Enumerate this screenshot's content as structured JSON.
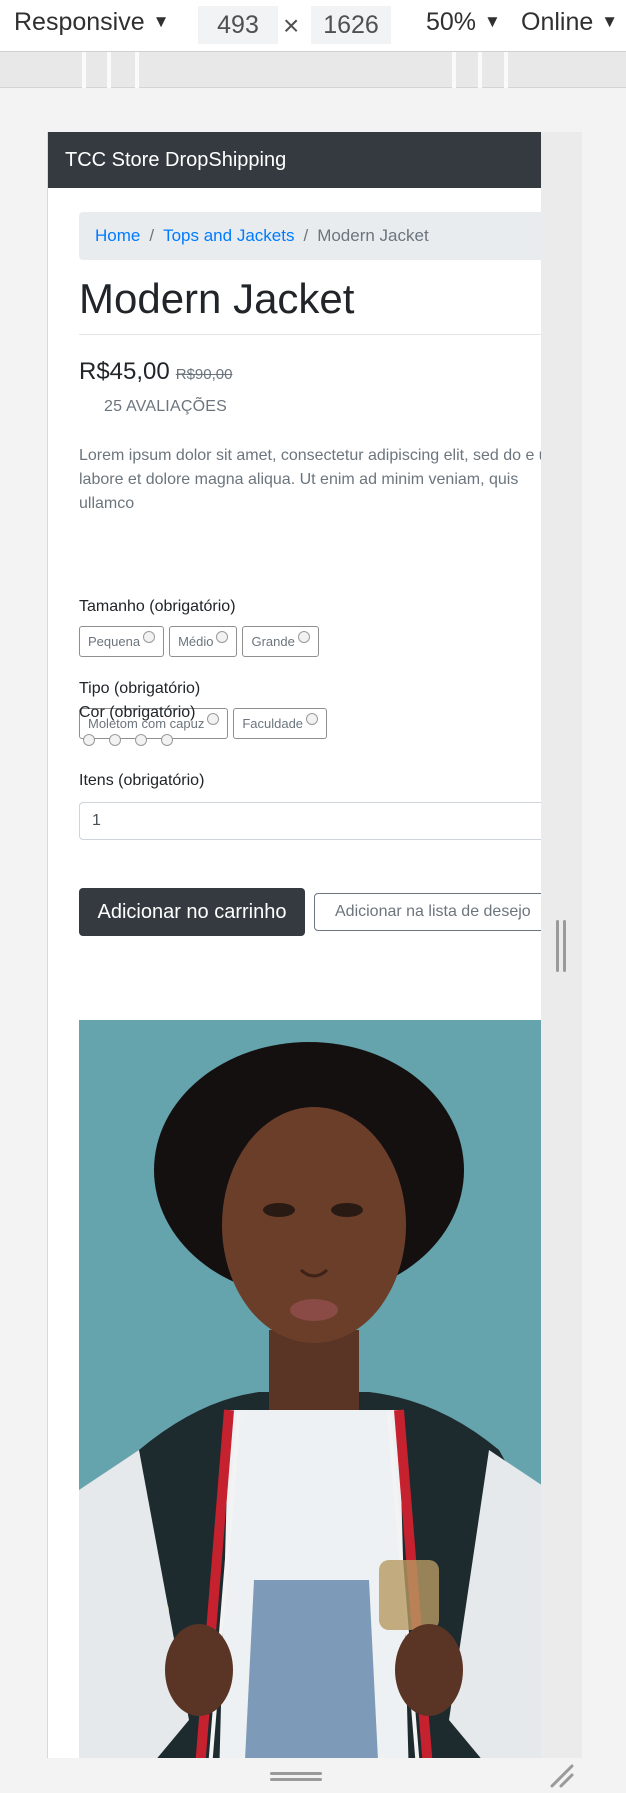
{
  "devtools": {
    "device": "Responsive",
    "width": "493",
    "times": "×",
    "height": "1626",
    "zoom": "50%",
    "network": "Online",
    "caret": "▼"
  },
  "navbar": {
    "brand": "TCC Store DropShipping"
  },
  "breadcrumb": {
    "home": "Home",
    "category": "Tops and Jackets",
    "current": "Modern Jacket",
    "separator": "/"
  },
  "product": {
    "title": "Modern Jacket",
    "price": "R$45,00",
    "old_price": "R$90,00",
    "reviews": "25 AVALIAÇÕES",
    "description": "Lorem ipsum dolor sit amet, consectetur adipiscing elit, sed do e ut labore et dolore magna aliqua. Ut enim ad minim veniam, quis ullamco"
  },
  "options": {
    "size": {
      "label": "Tamanho (obrigatório)",
      "choices": [
        "Pequena",
        "Médio",
        "Grande"
      ]
    },
    "type": {
      "label": "Tipo (obrigatório)",
      "choices": [
        "Moletom com capuz",
        "Faculdade"
      ]
    },
    "color": {
      "label": "Cor (obrigatório)",
      "swatch_count": 4
    },
    "quantity": {
      "label": "Itens (obrigatório)",
      "value": "1"
    }
  },
  "actions": {
    "add_to_cart": "Adicionar no carrinho",
    "add_to_wishlist": "Adicionar na lista de desejo"
  },
  "colors": {
    "navbar_bg": "#343a40",
    "link": "#007bff",
    "muted": "#6c757d",
    "breadcrumb_bg": "#e9ecef"
  },
  "image": {
    "subject": "model-wearing-jacket-photo"
  }
}
